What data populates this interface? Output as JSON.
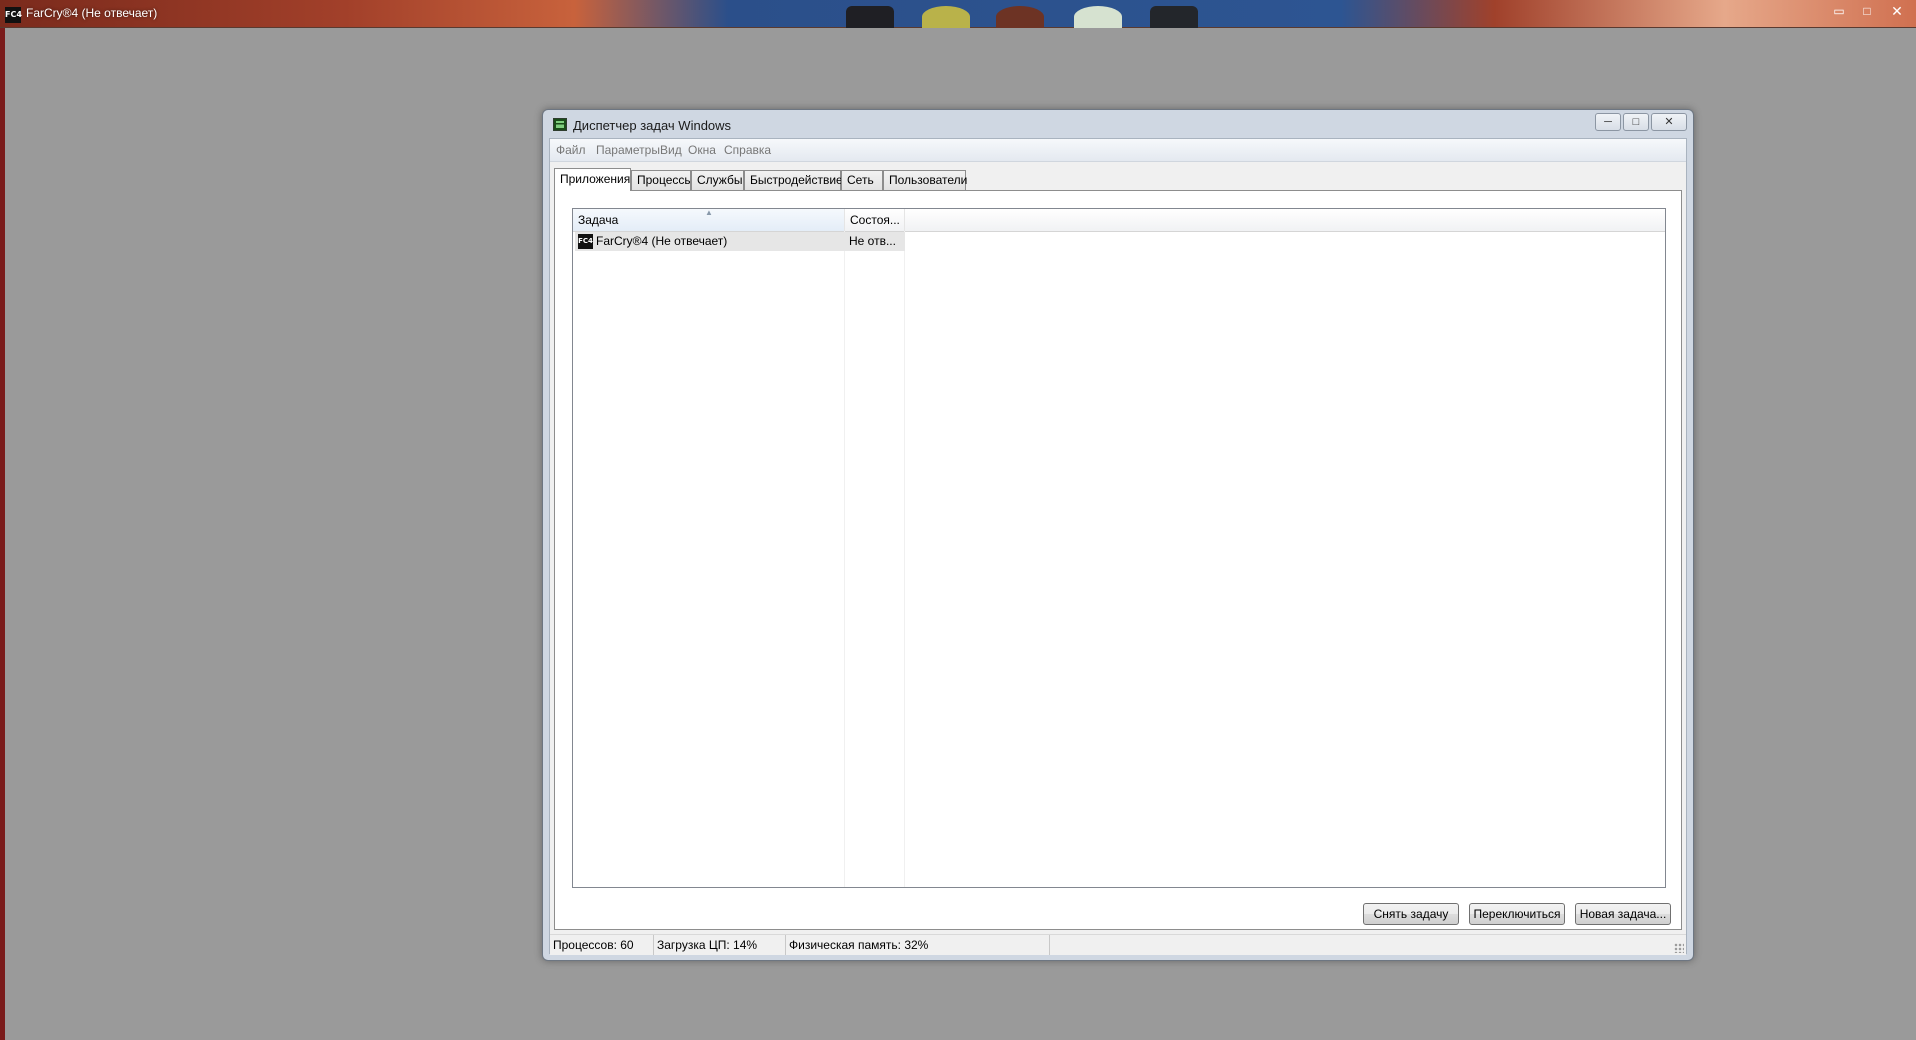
{
  "game_window": {
    "title": "FarCry®4 (Не отвечает)",
    "icon": "farcry4-icon",
    "controls": {
      "minimize": "▭",
      "maximize": "□",
      "close": "✕"
    }
  },
  "task_manager": {
    "title": "Диспетчер задач Windows",
    "controls": {
      "minimize": "─",
      "maximize": "□",
      "close": "✕"
    },
    "menu": [
      "Файл",
      "Параметры",
      "Вид",
      "Окна",
      "Справка"
    ],
    "tabs": [
      "Приложения",
      "Процессы",
      "Службы",
      "Быстродействие",
      "Сеть",
      "Пользователи"
    ],
    "active_tab": "Приложения",
    "table": {
      "columns": [
        "Задача",
        "Состоя..."
      ],
      "sort_indicator": "▲",
      "rows": [
        {
          "task": "FarCry®4 (Не отвечает)",
          "status": "Не отв...",
          "icon": "farcry4-icon",
          "icon_text": "FC4"
        }
      ]
    },
    "buttons": {
      "end_task": "Снять задачу",
      "switch_to": "Переключиться",
      "new_task": "Новая задача..."
    },
    "status_bar": {
      "processes": "Процессов: 60",
      "cpu": "Загрузка ЦП: 14%",
      "memory": "Физическая память: 32%"
    }
  },
  "colors": {
    "desktop_bg": "#9a9a9a",
    "window_frame": "#cfd7e2",
    "selected_row": "#e6e6e6"
  }
}
